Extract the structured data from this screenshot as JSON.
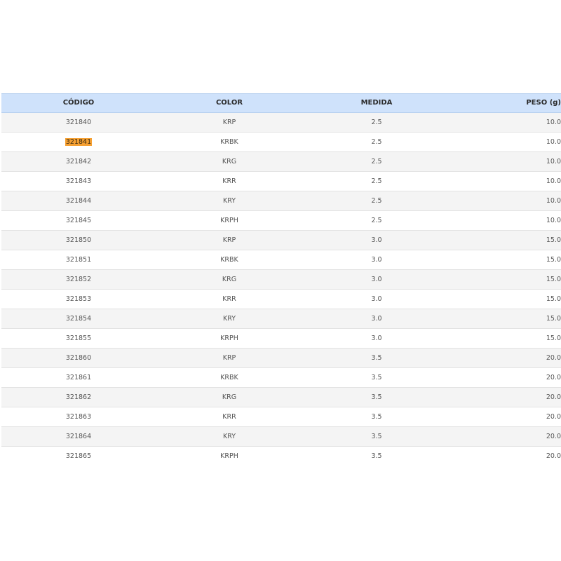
{
  "table": {
    "headers": {
      "code": "CÓDIGO",
      "color": "COLOR",
      "size": "MEDIDA",
      "weight": "PESO (g)"
    },
    "highlighted_row": 1,
    "highlight_color": "#f5a033",
    "header_bg": "#cfe2fb",
    "rows": [
      {
        "code": "321840",
        "color": "KRP",
        "size": "2.5",
        "weight": "10.0"
      },
      {
        "code": "321841",
        "color": "KRBK",
        "size": "2.5",
        "weight": "10.0"
      },
      {
        "code": "321842",
        "color": "KRG",
        "size": "2.5",
        "weight": "10.0"
      },
      {
        "code": "321843",
        "color": "KRR",
        "size": "2.5",
        "weight": "10.0"
      },
      {
        "code": "321844",
        "color": "KRY",
        "size": "2.5",
        "weight": "10.0"
      },
      {
        "code": "321845",
        "color": "KRPH",
        "size": "2.5",
        "weight": "10.0"
      },
      {
        "code": "321850",
        "color": "KRP",
        "size": "3.0",
        "weight": "15.0"
      },
      {
        "code": "321851",
        "color": "KRBK",
        "size": "3.0",
        "weight": "15.0"
      },
      {
        "code": "321852",
        "color": "KRG",
        "size": "3.0",
        "weight": "15.0"
      },
      {
        "code": "321853",
        "color": "KRR",
        "size": "3.0",
        "weight": "15.0"
      },
      {
        "code": "321854",
        "color": "KRY",
        "size": "3.0",
        "weight": "15.0"
      },
      {
        "code": "321855",
        "color": "KRPH",
        "size": "3.0",
        "weight": "15.0"
      },
      {
        "code": "321860",
        "color": "KRP",
        "size": "3.5",
        "weight": "20.0"
      },
      {
        "code": "321861",
        "color": "KRBK",
        "size": "3.5",
        "weight": "20.0"
      },
      {
        "code": "321862",
        "color": "KRG",
        "size": "3.5",
        "weight": "20.0"
      },
      {
        "code": "321863",
        "color": "KRR",
        "size": "3.5",
        "weight": "20.0"
      },
      {
        "code": "321864",
        "color": "KRY",
        "size": "3.5",
        "weight": "20.0"
      },
      {
        "code": "321865",
        "color": "KRPH",
        "size": "3.5",
        "weight": "20.0"
      }
    ]
  }
}
